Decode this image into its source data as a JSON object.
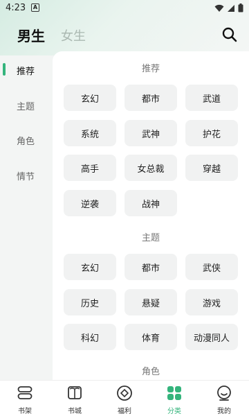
{
  "status_bar": {
    "time": "4:23",
    "notif_glyph": "A"
  },
  "header": {
    "tab_male": "男生",
    "tab_female": "女生"
  },
  "sidebar": {
    "items": [
      {
        "label": "推荐",
        "active": true
      },
      {
        "label": "主题",
        "active": false
      },
      {
        "label": "角色",
        "active": false
      },
      {
        "label": "情节",
        "active": false
      }
    ]
  },
  "sections": {
    "recommend": {
      "title": "推荐",
      "tags": [
        "玄幻",
        "都市",
        "武道",
        "系统",
        "武神",
        "护花",
        "高手",
        "女总裁",
        "穿越",
        "逆袭",
        "战神"
      ]
    },
    "theme": {
      "title": "主题",
      "tags": [
        "玄幻",
        "都市",
        "武侠",
        "历史",
        "悬疑",
        "游戏",
        "科幻",
        "体育",
        "动漫同人"
      ]
    },
    "role": {
      "title": "角色"
    }
  },
  "bottom_nav": {
    "items": [
      {
        "label": "书架",
        "icon": "bookshelf-icon"
      },
      {
        "label": "书城",
        "icon": "book-icon"
      },
      {
        "label": "福利",
        "icon": "coin-icon"
      },
      {
        "label": "分类",
        "icon": "category-icon",
        "active": true
      },
      {
        "label": "我的",
        "icon": "profile-icon"
      }
    ]
  },
  "colors": {
    "accent": "#34b47c",
    "tag_bg": "#f1f2f2"
  }
}
